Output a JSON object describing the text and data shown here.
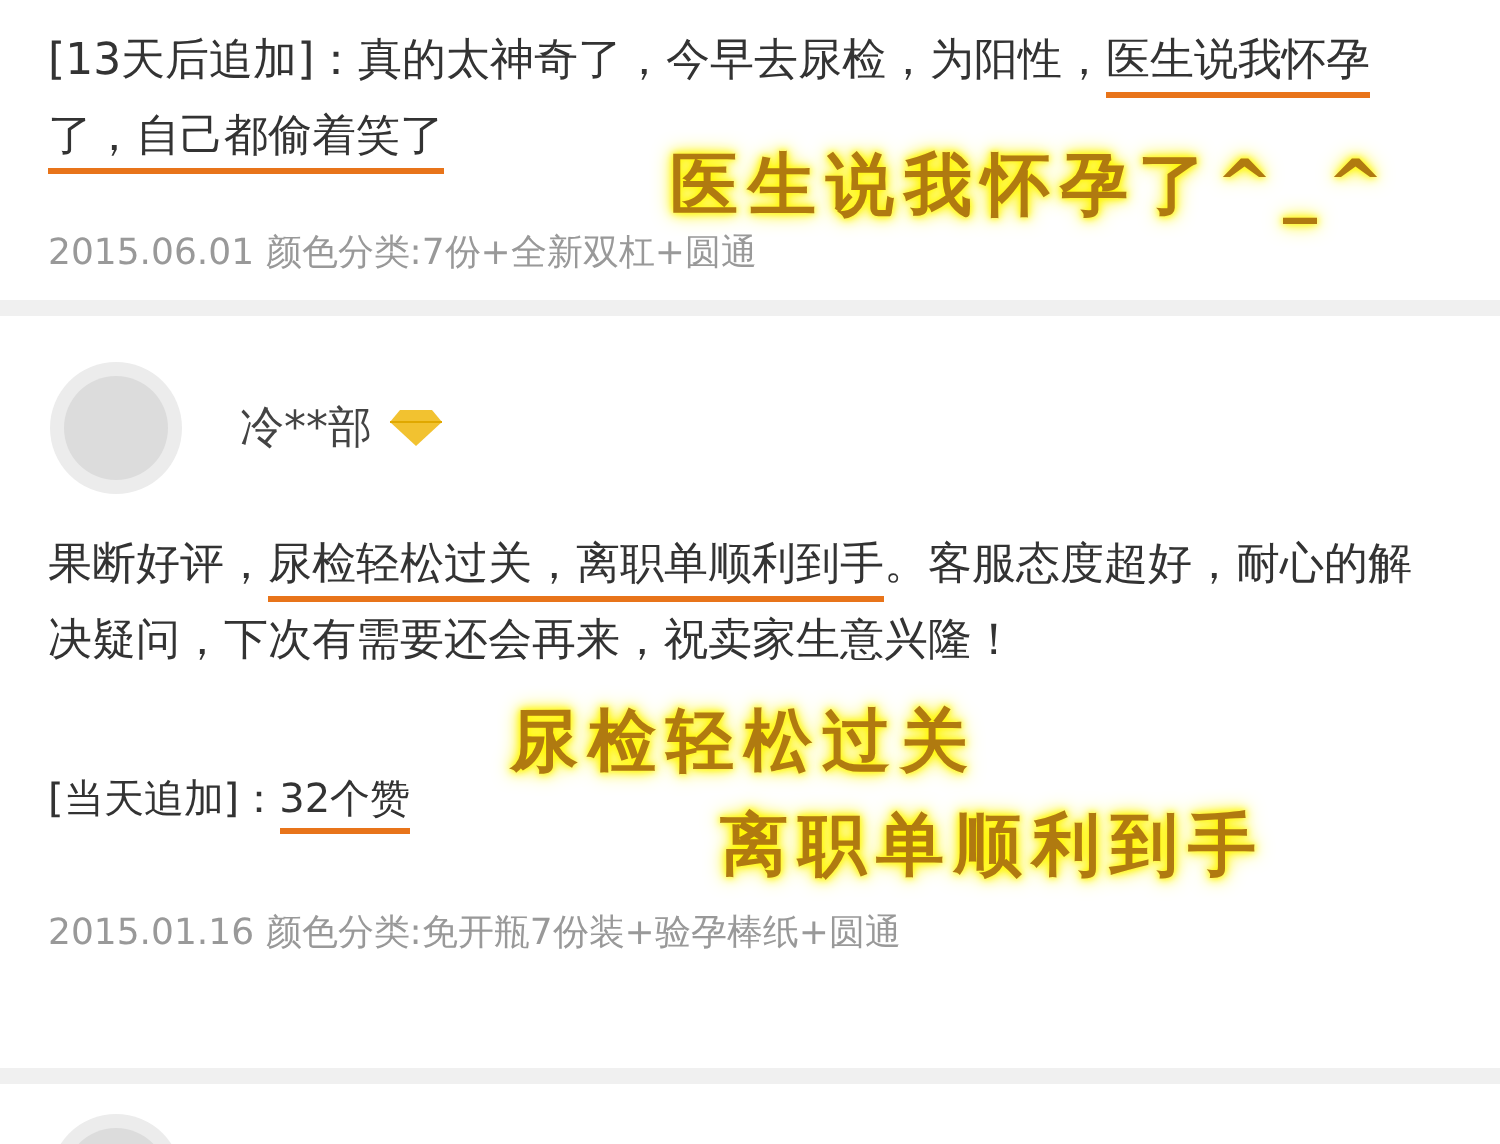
{
  "reviews": [
    {
      "kind": "followup",
      "segments": [
        {
          "text": "[13天后追加]：真的太神奇了，今早去尿检，为阳性，",
          "underlined": false
        },
        {
          "text": "医生说我怀孕了，自己都偷着笑了",
          "underlined": true
        }
      ],
      "meta": "2015.06.01 颜色分类:7份+全新双杠+圆通",
      "stamps": [
        "医生说我怀孕了^_^"
      ]
    },
    {
      "kind": "full",
      "user": {
        "name": "冷**部",
        "vip": true
      },
      "segments": [
        {
          "text": "果断好评，",
          "underlined": false
        },
        {
          "text": "尿检轻松过关，离职单顺利到手",
          "underlined": true
        },
        {
          "text": "。客服态度超好，耐心的解决疑问，下次有需要还会再来，祝卖家生意兴隆！",
          "underlined": false
        }
      ],
      "followup": {
        "label": "[当天追加]：",
        "segments": [
          {
            "text": "32个赞",
            "underlined": true
          }
        ]
      },
      "meta": "2015.01.16 颜色分类:免开瓶7份装+验孕棒纸+圆通",
      "stamps": [
        "尿检轻松过关",
        "离职单顺利到手"
      ]
    },
    {
      "kind": "cut"
    }
  ]
}
